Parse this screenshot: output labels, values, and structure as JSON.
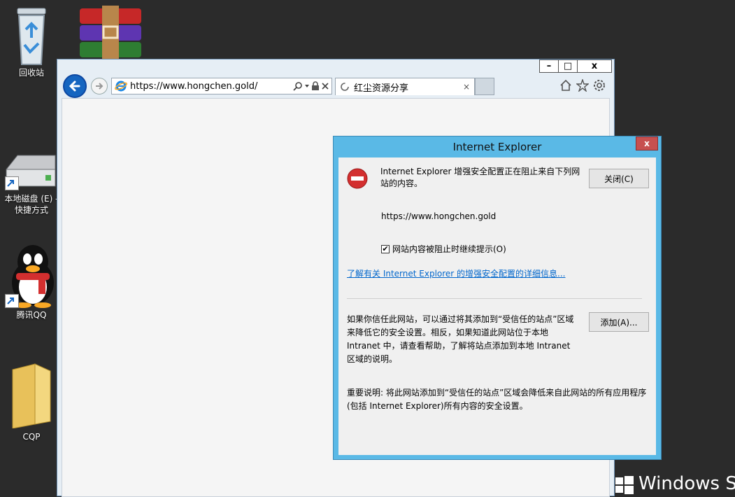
{
  "desktop": {
    "icons": [
      {
        "label": "回收站"
      },
      {
        "label": ""
      },
      {
        "label": "本地磁盘 (E) - 快捷方式"
      },
      {
        "label": "腾讯QQ"
      },
      {
        "label": "CQP"
      }
    ]
  },
  "ie": {
    "window_controls": {
      "minimize": "–",
      "maximize": "□",
      "close": "x"
    },
    "address": "https://www.hongchen.gold/",
    "tab_title": "红尘资源分享",
    "tab_close": "×"
  },
  "dialog": {
    "title": "Internet Explorer",
    "close_glyph": "x",
    "message": "Internet Explorer 增强安全配置正在阻止来自下列网站的内容。",
    "close_button": "关闭(C)",
    "blocked_url": "https://www.hongchen.gold",
    "checkbox_label": "网站内容被阻止时继续提示(O)",
    "checkbox_checked": true,
    "learn_more_link": "了解有关 Internet Explorer 的增强安全配置的详细信息...",
    "trust_text": "如果你信任此网站，可以通过将其添加到“受信任的站点”区域来降低它的安全设置。相反，如果知道此网站位于本地 Intranet 中，请查看帮助，了解将站点添加到本地 Intranet 区域的说明。",
    "add_button": "添加(A)...",
    "important_text": "重要说明: 将此网站添加到“受信任的站点”区域会降低来自此网站的所有应用程序(包括 Internet Explorer)所有内容的安全设置。"
  },
  "watermark": {
    "text": "Windows S"
  },
  "colors": {
    "dialog_frame": "#5ab9e6",
    "link": "#0066cc",
    "close_red": "#c75050",
    "ie_blue": "#1565c0"
  }
}
